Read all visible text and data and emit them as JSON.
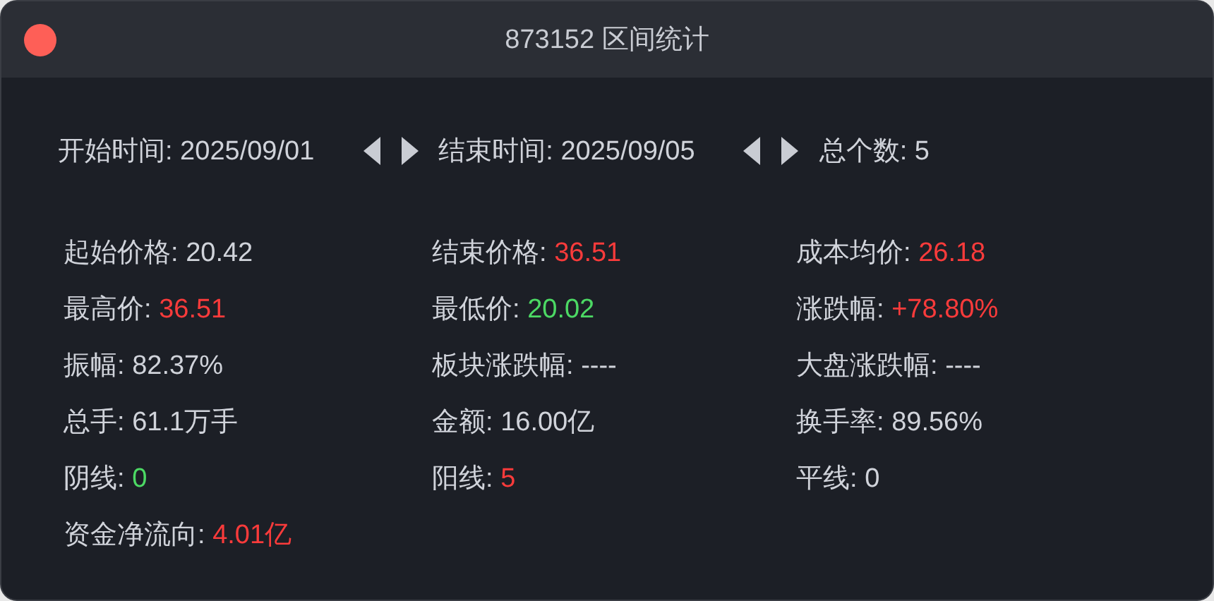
{
  "window": {
    "title": "873152 区间统计"
  },
  "range": {
    "start": "开始时间: 2025/09/01",
    "end": "结束时间: 2025/09/05",
    "count": "总个数: 5"
  },
  "stats": [
    {
      "label": "起始价格: ",
      "value": "20.42"
    },
    {
      "label": "结束价格: ",
      "value": "36.51",
      "color": "#fa3b3b"
    },
    {
      "label": "成本均价: ",
      "value": "26.18",
      "color": "#fa3b3b"
    },
    {
      "label": "最高价: ",
      "value": "36.51",
      "color": "#fa3b3b"
    },
    {
      "label": "最低价: ",
      "value": "20.02",
      "color": "#4cd964"
    },
    {
      "label": "涨跌幅: ",
      "value": "+78.80%",
      "color": "#fa3b3b"
    },
    {
      "label": "振幅: ",
      "value": "82.37%"
    },
    {
      "label": "板块涨跌幅: ",
      "value": "----"
    },
    {
      "label": "大盘涨跌幅: ",
      "value": "----"
    },
    {
      "label": "总手: ",
      "value": "61.1万手"
    },
    {
      "label": "金额: ",
      "value": "16.00亿"
    },
    {
      "label": "换手率: ",
      "value": "89.56%"
    },
    {
      "label": "阴线: ",
      "value": "0",
      "color": "#4cd964"
    },
    {
      "label": "阳线: ",
      "value": "5",
      "color": "#fa3b3b"
    },
    {
      "label": "平线: ",
      "value": "0"
    },
    {
      "label": "资金净流向: ",
      "value": "4.01亿",
      "color": "#fa3b3b"
    }
  ]
}
